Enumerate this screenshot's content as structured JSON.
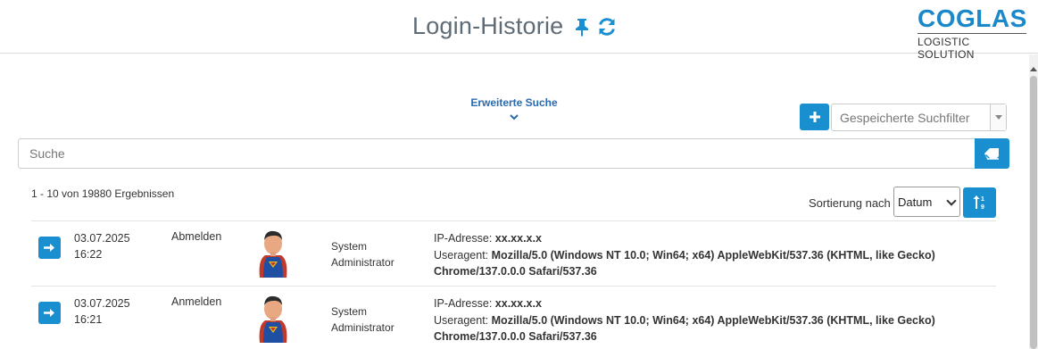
{
  "header": {
    "title": "Login-Historie",
    "pin_icon": "pin-icon",
    "refresh_icon": "refresh-icon",
    "logo_main": "COGLAS",
    "logo_sub": "LOGISTIC SOLUTION"
  },
  "search": {
    "advanced_label": "Erweiterte Suche",
    "saved_filters_placeholder": "Gespeicherte Suchfilter",
    "placeholder": "Suche",
    "value": ""
  },
  "results": {
    "count_text": "1 - 10 von 19880 Ergebnissen",
    "sort_label": "Sortierung nach",
    "sort_value": "Datum"
  },
  "rows": [
    {
      "date": "03.07.2025",
      "time": "16:22",
      "action": "Abmelden",
      "user_line1": "System",
      "user_line2": "Administrator",
      "ip_label": "IP-Adresse:",
      "ip_value": "xx.xx.x.x",
      "ua_label": "Useragent:",
      "ua_value_line1": "Mozilla/5.0 (Windows NT 10.0; Win64; x64) AppleWebKit/537.36 (KHTML, like Gecko)",
      "ua_value_line2": "Chrome/137.0.0.0 Safari/537.36"
    },
    {
      "date": "03.07.2025",
      "time": "16:21",
      "action": "Anmelden",
      "user_line1": "System",
      "user_line2": "Administrator",
      "ip_label": "IP-Adresse:",
      "ip_value": "xx.xx.x.x",
      "ua_label": "Useragent:",
      "ua_value_line1": "Mozilla/5.0 (Windows NT 10.0; Win64; x64) AppleWebKit/537.36 (KHTML, like Gecko)",
      "ua_value_line2": "Chrome/137.0.0.0 Safari/537.36"
    }
  ],
  "colors": {
    "accent": "#1a8fd0",
    "title": "#5f6b75",
    "link": "#2a6ab0"
  }
}
